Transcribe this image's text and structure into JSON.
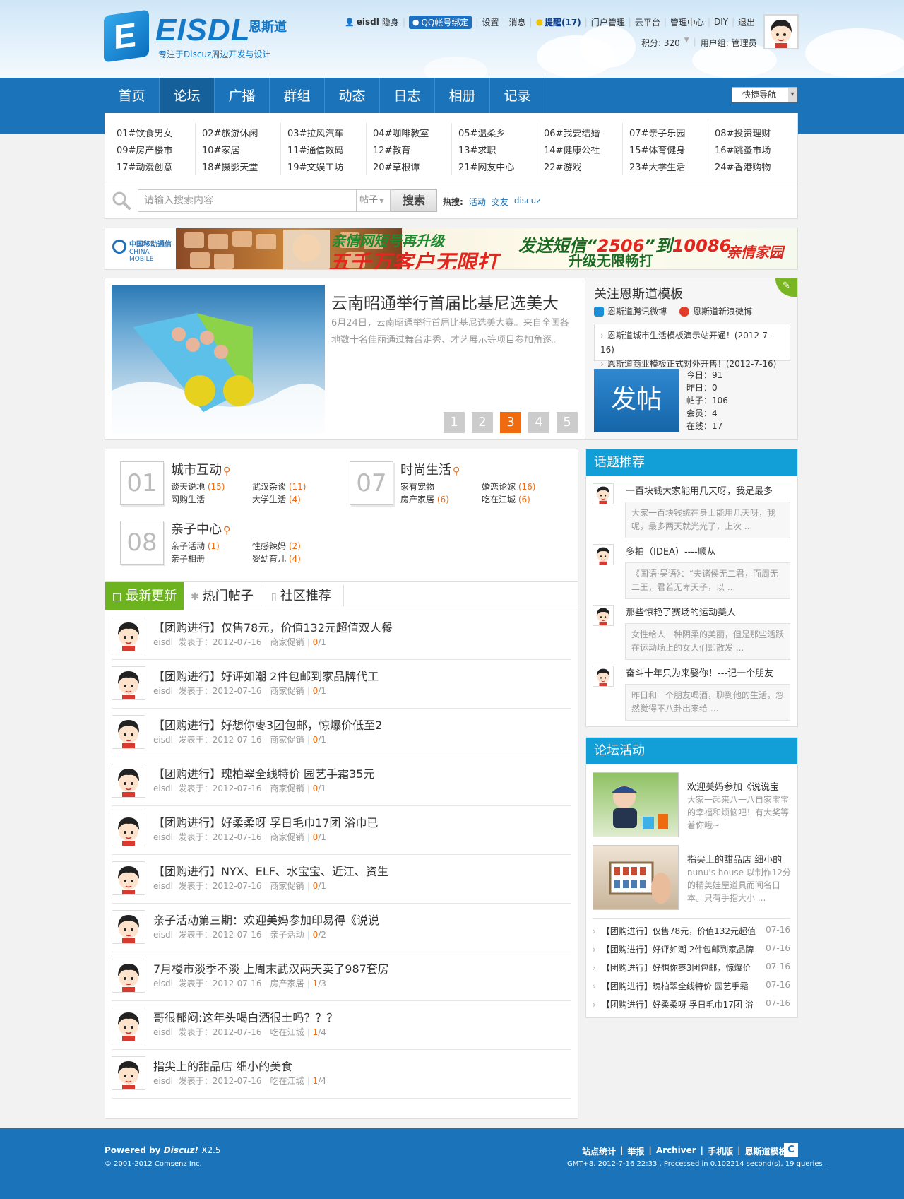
{
  "header": {
    "logo_text": "EISDL",
    "logo_cn": "恩斯道",
    "slogan": "专注于Discuz周边开发与设计",
    "user": "eisdl",
    "status": "隐身",
    "qq_bind": "QQ帐号绑定",
    "links": [
      "设置",
      "消息"
    ],
    "remind": "提醒(17)",
    "links2": [
      "门户管理",
      "云平台",
      "管理中心",
      "DIY",
      "退出"
    ],
    "credits": "积分: 320",
    "usergroup": "用户组: 管理员"
  },
  "nav": {
    "items": [
      "首页",
      "论坛",
      "广播",
      "群组",
      "动态",
      "日志",
      "相册",
      "记录"
    ],
    "active": "论坛",
    "quick_nav": "快捷导航"
  },
  "forum_grid": [
    [
      "01#饮食男女",
      "02#旅游休闲",
      "03#拉风汽车",
      "04#咖啡教室",
      "05#温柔乡",
      "06#我要结婚",
      "07#亲子乐园",
      "08#投资理财"
    ],
    [
      "09#房产楼市",
      "10#家居",
      "11#通信数码",
      "12#教育",
      "13#求职",
      "14#健康公社",
      "15#体育健身",
      "16#跳蚤市场"
    ],
    [
      "17#动漫创意",
      "18#摄影天堂",
      "19#文娱工坊",
      "20#草根谭",
      "21#网友中心",
      "22#游戏",
      "23#大学生活",
      "24#香港购物"
    ]
  ],
  "search": {
    "placeholder": "请输入搜索内容",
    "type": "帖子",
    "button": "搜索",
    "hot_label": "热搜:",
    "hot": [
      "活动",
      "交友",
      "discuz"
    ]
  },
  "banner": {
    "t1": "亲情网短号再升级",
    "t2": "五千万客户无限打",
    "t3a": "发送短信“",
    "t3b": "2506",
    "t3c": "”到",
    "t3d": "10086",
    "t4": "升级无限畅打",
    "t5": "亲情家园",
    "mobile": "中国移动通信",
    "mobile_en": "CHINA MOBILE"
  },
  "slider": {
    "title": "云南昭通举行首届比基尼选美大",
    "desc": "6月24日，云南昭通举行首届比基尼选美大赛。来自全国各地数十名佳丽通过舞台走秀、才艺展示等项目参加角逐。",
    "pages": [
      "1",
      "2",
      "3",
      "4",
      "5"
    ],
    "active_page": "3"
  },
  "follow": {
    "title": "关注恩斯道模板",
    "tencent": "恩斯道腾讯微博",
    "sina": "恩斯道新浪微博",
    "notices": [
      "恩斯道城市生活模板演示站开通！(2012-7-16)",
      "恩斯道商业模板正式对外开售！(2012-7-16)"
    ],
    "post_button": "发帖",
    "stats": [
      "今日：91",
      "昨日：0",
      "帖子：106",
      "会员：4",
      "在线：17"
    ]
  },
  "categories": [
    {
      "num": "01",
      "name": "城市互动",
      "subs": [
        [
          "谈天说地",
          "(15)"
        ],
        [
          "武汉杂谈",
          "(11)"
        ],
        [
          "网购生活",
          ""
        ],
        [
          "大学生活",
          "(4)"
        ]
      ]
    },
    {
      "num": "07",
      "name": "时尚生活",
      "subs": [
        [
          "家有宠物",
          ""
        ],
        [
          "婚恋论嫁",
          "(16)"
        ],
        [
          "房产家居",
          "(6)"
        ],
        [
          "吃在江城",
          "(6)"
        ]
      ]
    },
    {
      "num": "08",
      "name": "亲子中心",
      "subs": [
        [
          "亲子活动",
          "(1)"
        ],
        [
          "性感辣妈",
          "(2)"
        ],
        [
          "亲子相册",
          ""
        ],
        [
          "婴幼育儿",
          "(4)"
        ]
      ]
    }
  ],
  "tabs": [
    "最新更新",
    "热门帖子",
    "社区推荐"
  ],
  "threads": [
    {
      "title": "【团购进行】仅售78元，价值132元超值双人餐",
      "author": "eisdl",
      "date": "发表于：2012-07-16",
      "forum": "商家促销",
      "r": "0",
      "v": "1"
    },
    {
      "title": "【团购进行】好评如潮 2件包邮到家品牌代工",
      "author": "eisdl",
      "date": "发表于：2012-07-16",
      "forum": "商家促销",
      "r": "0",
      "v": "1"
    },
    {
      "title": "【团购进行】好想你枣3团包邮，惊爆价低至2",
      "author": "eisdl",
      "date": "发表于：2012-07-16",
      "forum": "商家促销",
      "r": "0",
      "v": "1"
    },
    {
      "title": "【团购进行】瑰柏翠全线特价 园艺手霜35元",
      "author": "eisdl",
      "date": "发表于：2012-07-16",
      "forum": "商家促销",
      "r": "0",
      "v": "1"
    },
    {
      "title": "【团购进行】好柔柔呀 孚日毛巾17团 浴巾已",
      "author": "eisdl",
      "date": "发表于：2012-07-16",
      "forum": "商家促销",
      "r": "0",
      "v": "1"
    },
    {
      "title": "【团购进行】NYX、ELF、水宝宝、近江、资生",
      "author": "eisdl",
      "date": "发表于：2012-07-16",
      "forum": "商家促销",
      "r": "0",
      "v": "1"
    },
    {
      "title": "亲子活动第三期：欢迎美妈参加印易得《说说",
      "author": "eisdl",
      "date": "发表于：2012-07-16",
      "forum": "亲子活动",
      "r": "0",
      "v": "2"
    },
    {
      "title": "7月楼市淡季不淡 上周末武汉两天卖了987套房",
      "author": "eisdl",
      "date": "发表于：2012-07-16",
      "forum": "房产家居",
      "r": "1",
      "v": "3"
    },
    {
      "title": "哥很郁闷:这年头喝白酒很土吗？？？",
      "author": "eisdl",
      "date": "发表于：2012-07-16",
      "forum": "吃在江城",
      "r": "1",
      "v": "4"
    },
    {
      "title": "指尖上的甜品店 细小的美食",
      "author": "eisdl",
      "date": "发表于：2012-07-16",
      "forum": "吃在江城",
      "r": "1",
      "v": "4"
    }
  ],
  "topics": {
    "title": "话题推荐",
    "items": [
      {
        "title": "一百块钱大家能用几天呀，我是最多",
        "desc": "大家一百块钱统在身上能用几天呀，我呢，最多两天就光光了，上次 ..."
      },
      {
        "title": "多拍（IDEA）----顺从",
        "desc": "《国语·吴语》：“夫诸侯无二君，而周无二王，君若无卑天子，以 ..."
      },
      {
        "title": "那些惊艳了赛场的运动美人",
        "desc": "女性给人一种阴柔的美丽，但是那些活跃在运动场上的女人们却散发 ..."
      },
      {
        "title": "奋斗十年只为来娶你！---记一个朋友",
        "desc": "昨日和一个朋友喝酒，聊到他的生活，忽然觉得不八卦出来给 ..."
      }
    ]
  },
  "activities": {
    "title": "论坛活动",
    "items": [
      {
        "title": "欢迎美妈参加《说说宝",
        "desc": "大家一起来八一八自家宝宝的幸福和烦恼吧！有大奖等着你哦~"
      },
      {
        "title": "指尖上的甜品店 细小的",
        "desc": "nunu's house 以制作12分的精美娃屋道具而闻名日本。只有手指大小 ..."
      }
    ],
    "list": [
      {
        "t": "【团购进行】仅售78元，价值132元超值",
        "d": "07-16"
      },
      {
        "t": "【团购进行】好评如潮 2件包邮到家品牌",
        "d": "07-16"
      },
      {
        "t": "【团购进行】好想你枣3团包邮，惊爆价",
        "d": "07-16"
      },
      {
        "t": "【团购进行】瑰柏翠全线特价 园艺手霜",
        "d": "07-16"
      },
      {
        "t": "【团购进行】好柔柔呀 孚日毛巾17团 浴",
        "d": "07-16"
      }
    ]
  },
  "footer": {
    "powered": "Powered by",
    "discuz": "Discuz!",
    "version": "X2.5",
    "copyright": "© 2001-2012 Comsenz Inc.",
    "links": [
      "站点统计",
      "举报",
      "Archiver",
      "手机版",
      "恩斯道模板"
    ],
    "info": "GMT+8, 2012-7-16 22:33 , Processed in 0.102214 second(s), 19 queries ."
  },
  "colors": {
    "nav": "#1b73b9",
    "accent_orange": "#f06b0f",
    "green_tab": "#6db21f",
    "side_head": "#129fd8"
  }
}
